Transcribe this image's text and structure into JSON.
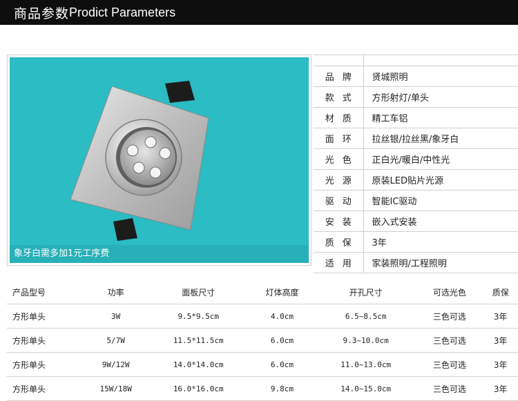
{
  "header": {
    "title_cn": "商品参数",
    "title_en": "Prodict Parameters"
  },
  "photo": {
    "caption": "象牙白需多加1元工序费"
  },
  "specs": [
    {
      "key": "",
      "value": ""
    },
    {
      "key": "品牌",
      "value": "贤城照明"
    },
    {
      "key": "款式",
      "value": "方形射灯/单头"
    },
    {
      "key": "材质",
      "value": "精工车铝"
    },
    {
      "key": "面环",
      "value": "拉丝银/拉丝黑/象牙白"
    },
    {
      "key": "光色",
      "value": "正白光/暖白/中性光"
    },
    {
      "key": "光源",
      "value": "原装LED贴片光源"
    },
    {
      "key": "驱动",
      "value": "智能IC驱动"
    },
    {
      "key": "安装",
      "value": "嵌入式安装"
    },
    {
      "key": "质保",
      "value": "3年"
    },
    {
      "key": "适用",
      "value": "家装照明/工程照明"
    }
  ],
  "models": {
    "headers": [
      "产品型号",
      "功率",
      "面板尺寸",
      "灯体高度",
      "开孔尺寸",
      "可选光色",
      "质保"
    ],
    "rows": [
      [
        "方形单头",
        "3W",
        "9.5*9.5cm",
        "4.0cm",
        "6.5~8.5cm",
        "三色可选",
        "3年"
      ],
      [
        "方形单头",
        "5/7W",
        "11.5*11.5cm",
        "6.0cm",
        "9.3~10.0cm",
        "三色可选",
        "3年"
      ],
      [
        "方形单头",
        "9W/12W",
        "14.0*14.0cm",
        "6.0cm",
        "11.0~13.0cm",
        "三色可选",
        "3年"
      ],
      [
        "方形单头",
        "15W/18W",
        "16.0*16.0cm",
        "9.8cm",
        "14.0~15.0cm",
        "三色可选",
        "3年"
      ]
    ]
  }
}
